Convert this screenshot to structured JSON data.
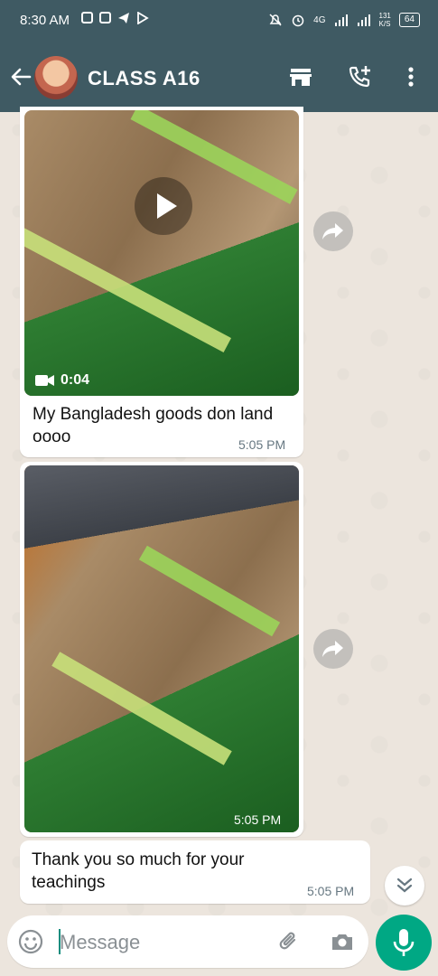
{
  "status_bar": {
    "time": "8:30 AM",
    "network": "4G",
    "speed_value": "131",
    "speed_unit": "K/S",
    "battery": "64"
  },
  "header": {
    "title": "CLASS A16",
    "icons": [
      "back-arrow-icon",
      "avatar",
      "store-icon",
      "add-call-icon",
      "more-vert-icon"
    ]
  },
  "messages": [
    {
      "type": "video",
      "duration": "0:04",
      "caption": "My Bangladesh goods don land oooo",
      "time": "5:05 PM"
    },
    {
      "type": "image",
      "time": "5:05 PM"
    },
    {
      "type": "text",
      "text": "Thank you so much for your teachings",
      "time": "5:05 PM"
    }
  ],
  "composer": {
    "placeholder": "Message"
  },
  "colors": {
    "header_bg": "#3f5a63",
    "chat_bg": "#ece5dd",
    "mic_button": "#00a884"
  }
}
